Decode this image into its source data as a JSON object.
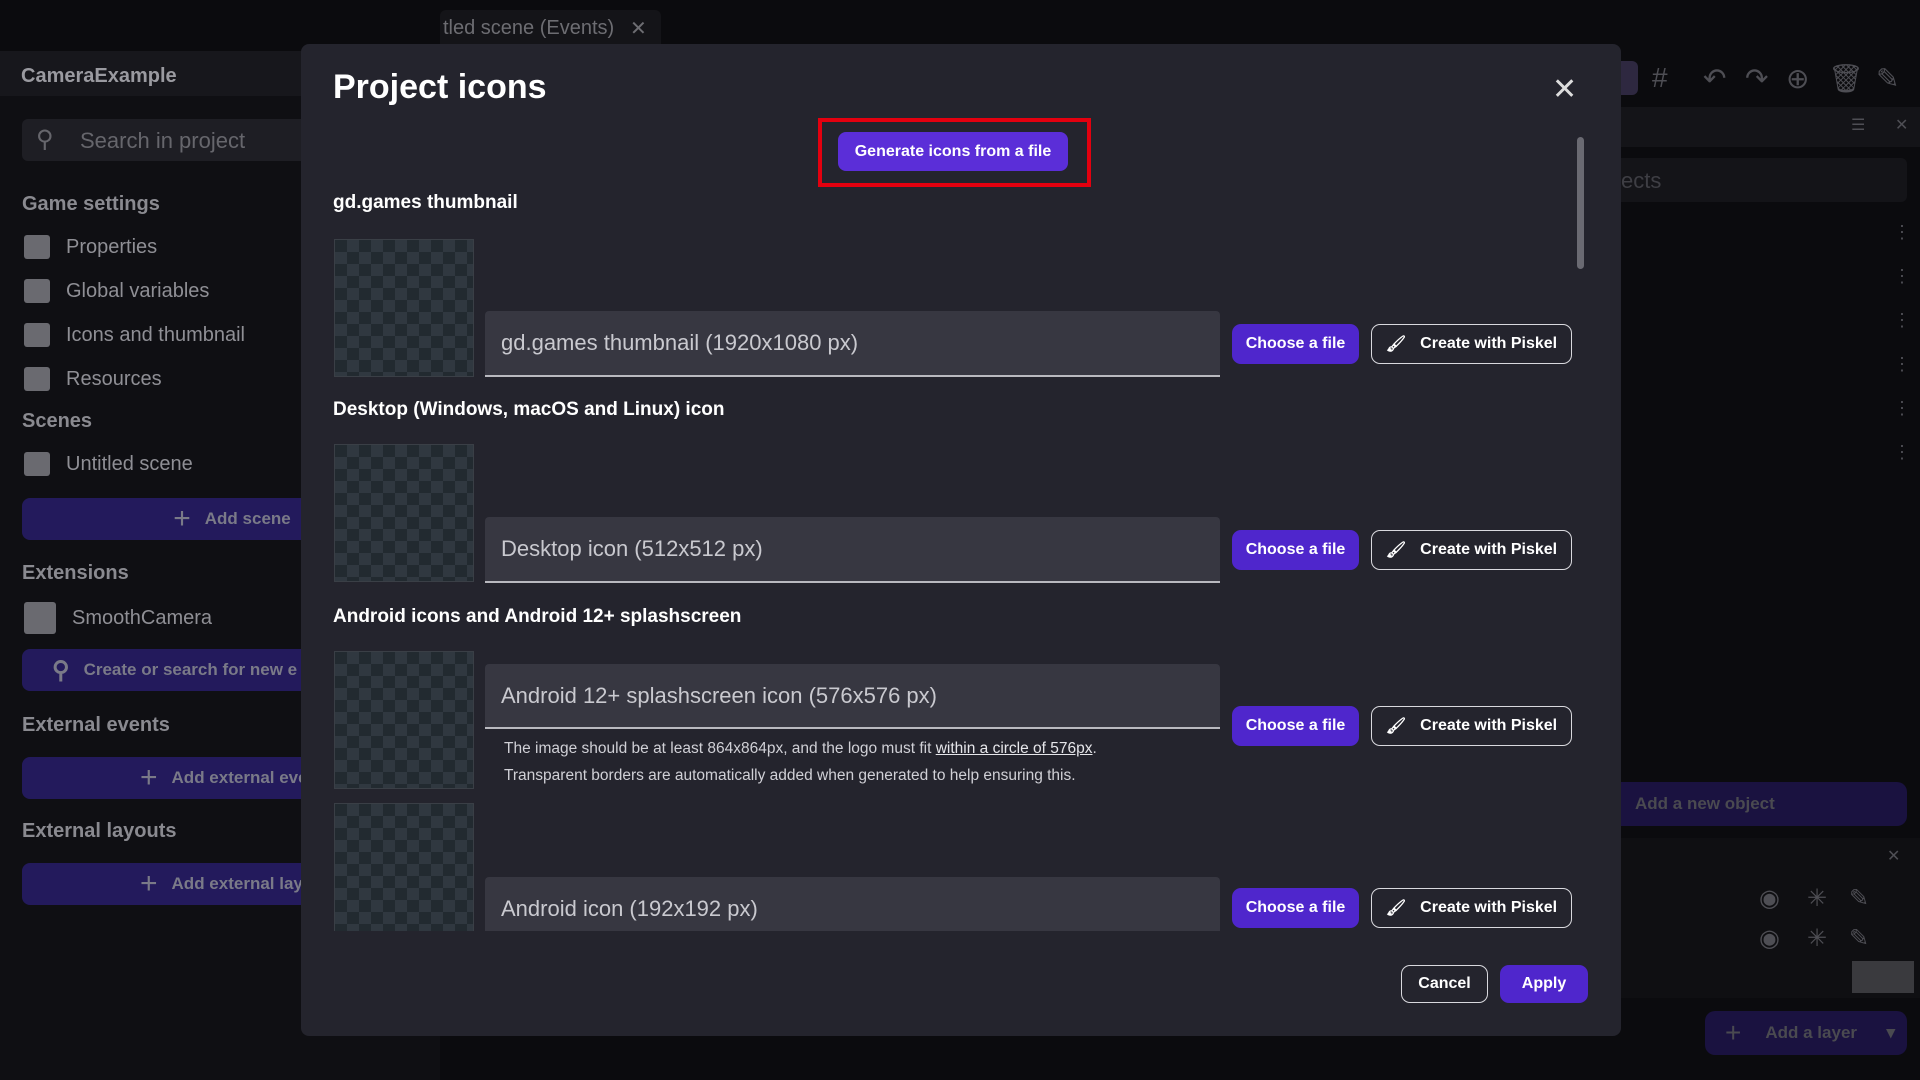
{
  "background": {
    "tab_title": "tled scene (Events)",
    "project_name": "CameraExample",
    "search_placeholder": "Search in project",
    "sections": {
      "game_settings": "Game settings",
      "scenes": "Scenes",
      "extensions": "Extensions",
      "external_events": "External events",
      "external_layouts": "External layouts"
    },
    "game_settings_items": [
      {
        "label": "Properties",
        "icon": "gear-icon"
      },
      {
        "label": "Global variables",
        "icon": "variables-icon"
      },
      {
        "label": "Icons and thumbnail",
        "icon": "image-icon"
      },
      {
        "label": "Resources",
        "icon": "resources-icon"
      }
    ],
    "scene_items": [
      {
        "label": "Untitled scene",
        "icon": "film-icon"
      }
    ],
    "add_scene": "Add scene",
    "extension_items": [
      {
        "label": "SmoothCamera",
        "icon": "camera-icon"
      }
    ],
    "search_extensions": "Create or search for new e",
    "add_external_events": "Add external even",
    "add_external_layouts": "Add external layou",
    "objects_search_partial": "ects",
    "add_object": "Add a new object",
    "add_layer": "Add a layer"
  },
  "dialog": {
    "title": "Project icons",
    "generate_button": "Generate icons from a file",
    "highlight_color": "#e3000f",
    "accent_color": "#4f26cc",
    "sections": [
      {
        "label": "gd.games thumbnail",
        "fields": [
          {
            "placeholder": "gd.games thumbnail (1920x1080 px)"
          }
        ]
      },
      {
        "label": "Desktop (Windows, macOS and Linux) icon",
        "fields": [
          {
            "placeholder": "Desktop icon (512x512 px)"
          }
        ]
      },
      {
        "label": "Android icons and Android 12+ splashscreen",
        "fields": [
          {
            "placeholder": "Android 12+ splashscreen icon (576x576 px)",
            "help_before": "The image should be at least 864x864px, and the logo must fit ",
            "help_link": "within a circle of 576px",
            "help_after": ".",
            "help_line2": "Transparent borders are automatically added when generated to help ensuring this."
          },
          {
            "placeholder": "Android icon (192x192 px)"
          }
        ]
      }
    ],
    "choose_file": "Choose a file",
    "create_piskel": "Create with Piskel",
    "cancel": "Cancel",
    "apply": "Apply"
  }
}
